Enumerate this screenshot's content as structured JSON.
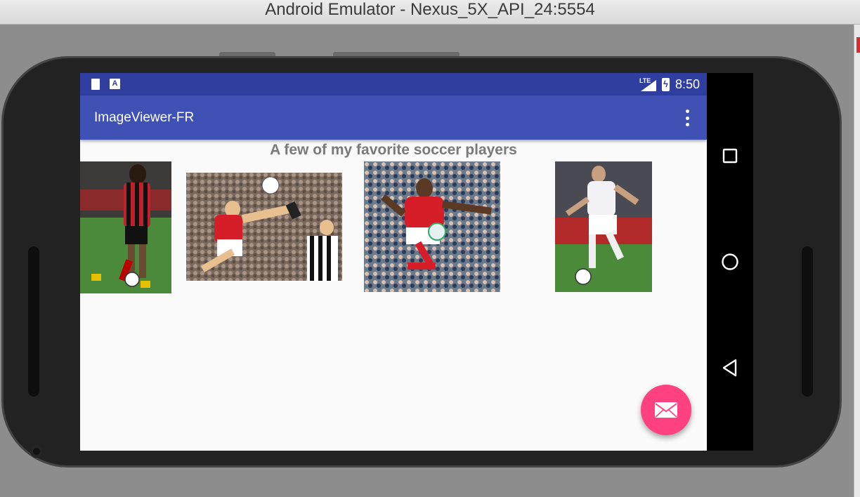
{
  "window": {
    "title": "Android Emulator - Nexus_5X_API_24:5554"
  },
  "status_bar": {
    "time": "8:50",
    "network": "LTE",
    "left_icons": [
      "sd-card-icon",
      "a-notification-icon"
    ],
    "color": "#303f9f"
  },
  "app_bar": {
    "title": "ImageViewer-FR",
    "color": "#3f51b5",
    "menu_icon": "more-vert-icon"
  },
  "content": {
    "heading": "A few of my favorite soccer players",
    "photos": [
      {
        "name": "photo-player-1",
        "description_icon": "soccer-player-photo"
      },
      {
        "name": "photo-player-2",
        "description_icon": "soccer-player-photo"
      },
      {
        "name": "photo-player-3",
        "description_icon": "soccer-player-photo"
      },
      {
        "name": "photo-player-4",
        "description_icon": "soccer-player-photo"
      }
    ]
  },
  "fab": {
    "icon": "email-icon",
    "color": "#ff4081"
  },
  "navigation": {
    "buttons": [
      "recents-icon",
      "home-icon",
      "back-icon"
    ]
  }
}
